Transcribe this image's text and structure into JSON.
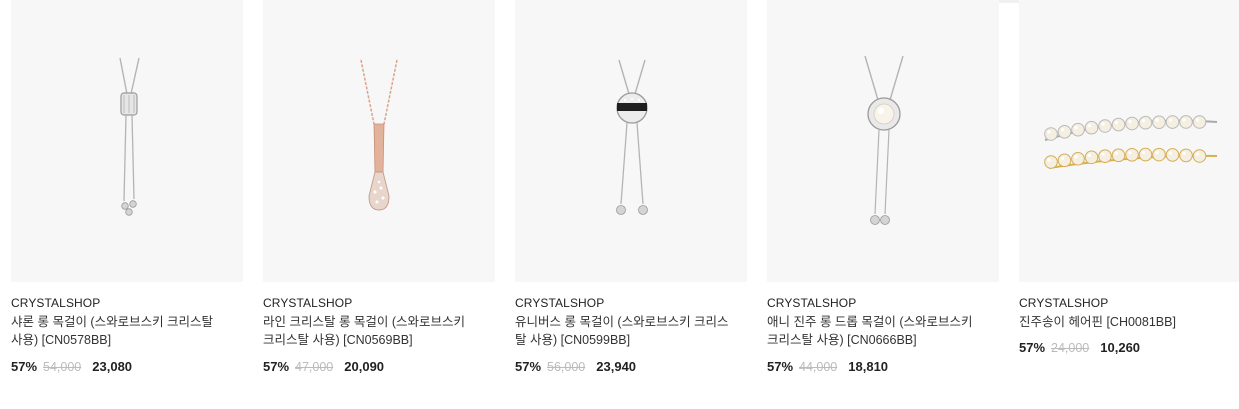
{
  "products": [
    {
      "brand": "CRYSTALSHOP",
      "name": "샤론 롱 목걸이 (스와로브스키 크리스탈 사용) [CN0578BB]",
      "discount": "57%",
      "original_price": "54,000",
      "sale_price": "23,080",
      "image": "silver-long-necklace-barrel"
    },
    {
      "brand": "CRYSTALSHOP",
      "name": "라인 크리스탈 롱 목걸이 (스와로브스키 크리스탈 사용) [CN0569BB]",
      "discount": "57%",
      "original_price": "47,000",
      "sale_price": "20,090",
      "image": "rose-gold-drop-necklace"
    },
    {
      "brand": "CRYSTALSHOP",
      "name": "유니버스 롱 목걸이 (스와로브스키 크리스탈 사용) [CN0599BB]",
      "discount": "57%",
      "original_price": "56,000",
      "sale_price": "23,940",
      "image": "silver-ball-slider-necklace"
    },
    {
      "brand": "CRYSTALSHOP",
      "name": "애니 진주 롱 드롭 목걸이 (스와로브스키 크리스탈 사용) [CN0666BB]",
      "discount": "57%",
      "original_price": "44,000",
      "sale_price": "18,810",
      "image": "silver-pearl-drop-necklace"
    },
    {
      "brand": "CRYSTALSHOP",
      "name": "진주송이 헤어핀 [CH0081BB]",
      "discount": "57%",
      "original_price": "24,000",
      "sale_price": "10,260",
      "image": "pearl-hairpins"
    }
  ],
  "colors": {
    "thumb_bg": "#f7f7f7",
    "text": "#222222",
    "strike": "#bbbbbb",
    "silver": "#b9b9b9",
    "rose_gold": "#d8a48e",
    "gold": "#d9b24a"
  }
}
